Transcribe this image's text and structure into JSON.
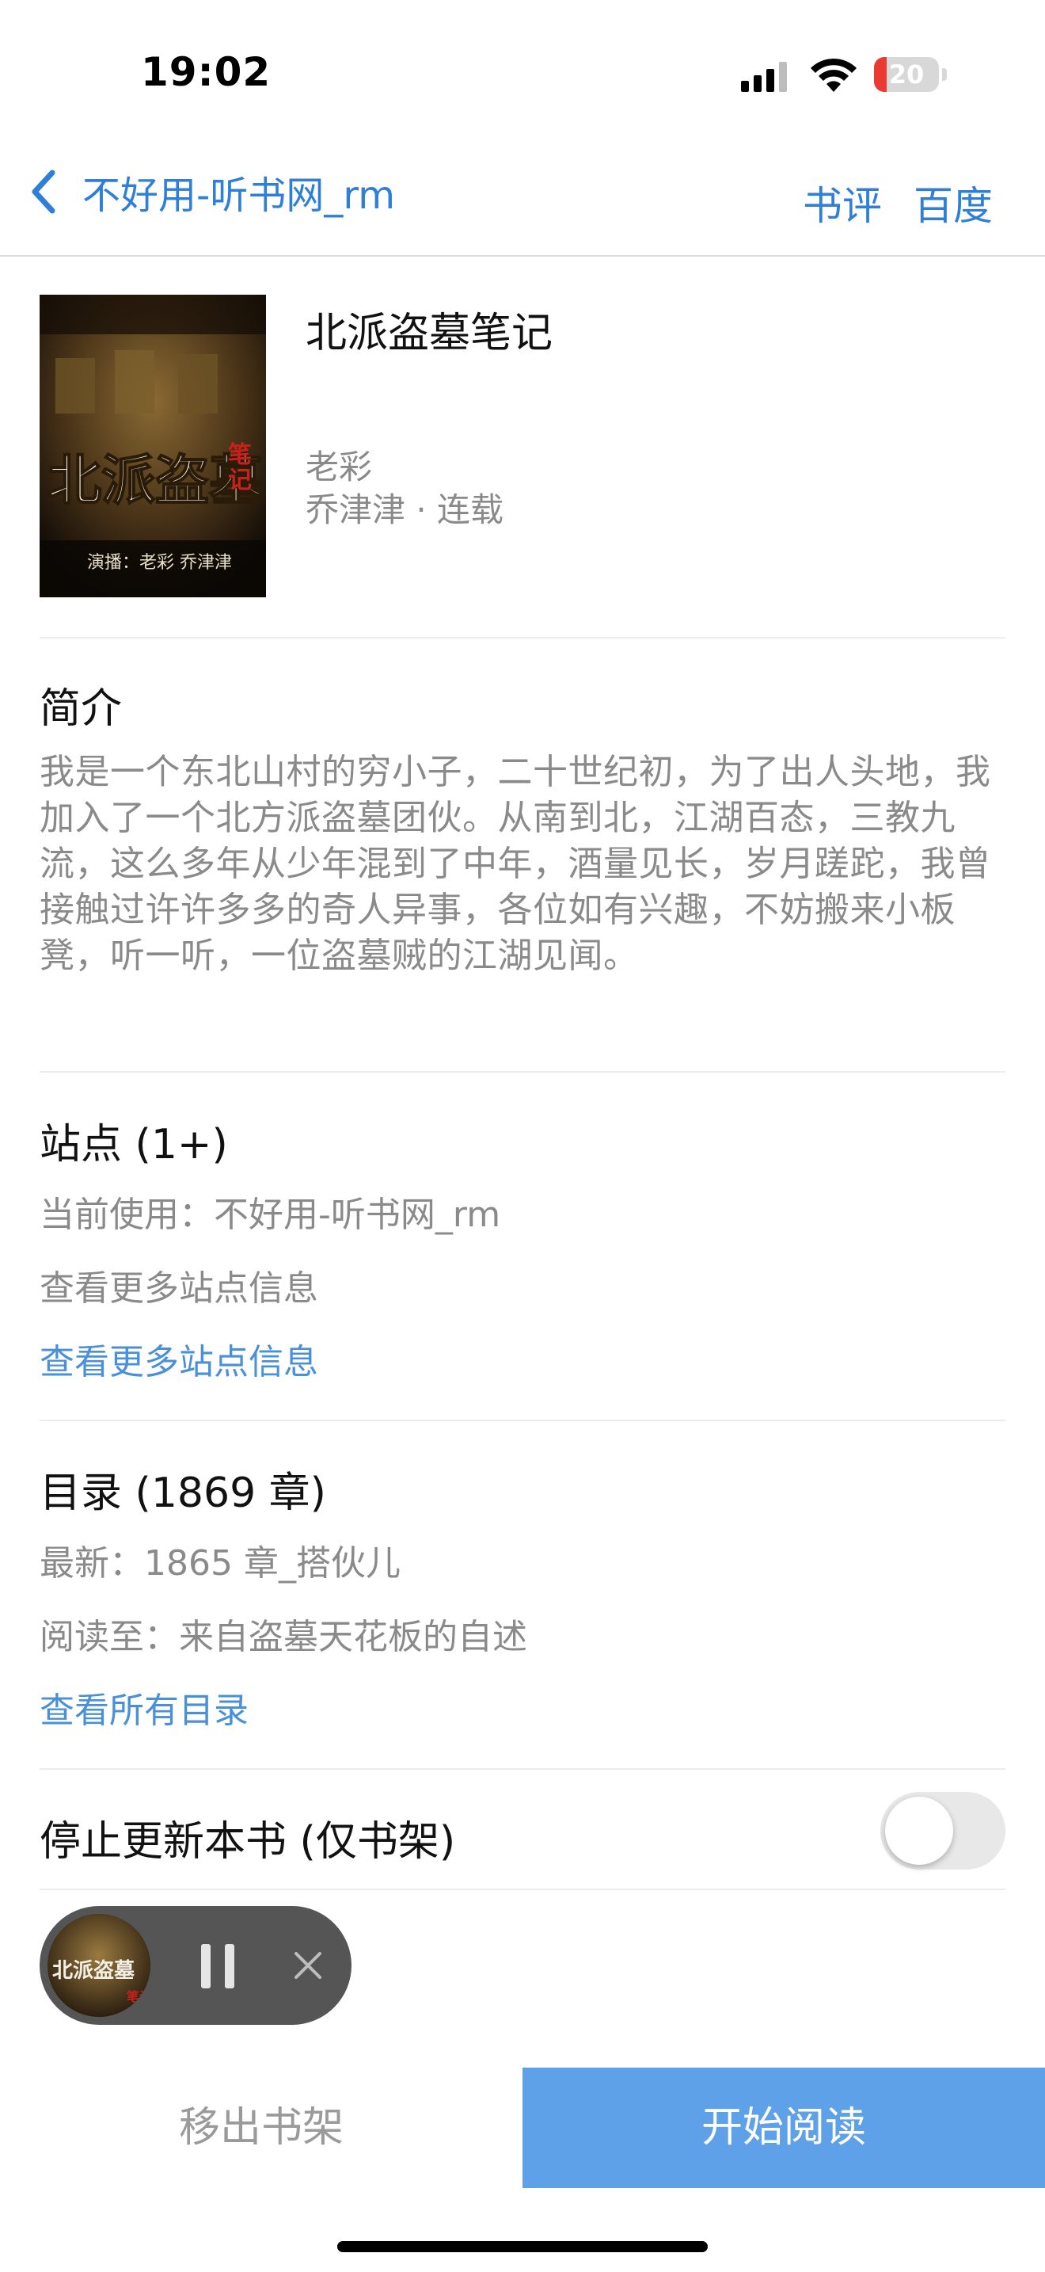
{
  "status_bar": {
    "time": "19:02",
    "battery_percent": "20",
    "battery_level": 0.2,
    "battery_color": "#e93a34"
  },
  "nav": {
    "back_label": "不好用-听书网_rm",
    "review": "书评",
    "baidu": "百度"
  },
  "book": {
    "title": "北派盗墓笔记",
    "author": "老彩",
    "meta": "乔津津 · 连载",
    "cover_lettering": "北派盗墓笔记 演播：老彩 乔津津"
  },
  "intro": {
    "title": "简介",
    "text": "我是一个东北山村的穷小子，二十世纪初，为了出人头地，我加入了一个北方派盗墓团伙。从南到北，江湖百态，三教九流，这么多年从少年混到了中年，酒量见长，岁月蹉跎，我曾接触过许许多多的奇人异事，各位如有兴趣，不妨搬来小板凳，听一听，一位盗墓贼的江湖见闻。"
  },
  "sites": {
    "title": "站点 (1+)",
    "current": "当前使用：不好用-听书网_rm",
    "more_info": "查看更多站点信息",
    "more_link": "查看更多站点信息"
  },
  "toc": {
    "title": "目录 (1869 章)",
    "latest": "最新：1865 章_搭伙儿",
    "read_to": "阅读至：来自盗墓天花板的自述",
    "view_all": "查看所有目录"
  },
  "settings": {
    "stop_update_label": "停止更新本书 (仅书架)",
    "stop_update_on": false
  },
  "bottom": {
    "remove": "移出书架",
    "start": "开始阅读"
  },
  "colors": {
    "accent": "#2f7ed8",
    "link": "#4a90d9",
    "start_button": "#5ea1e8"
  }
}
